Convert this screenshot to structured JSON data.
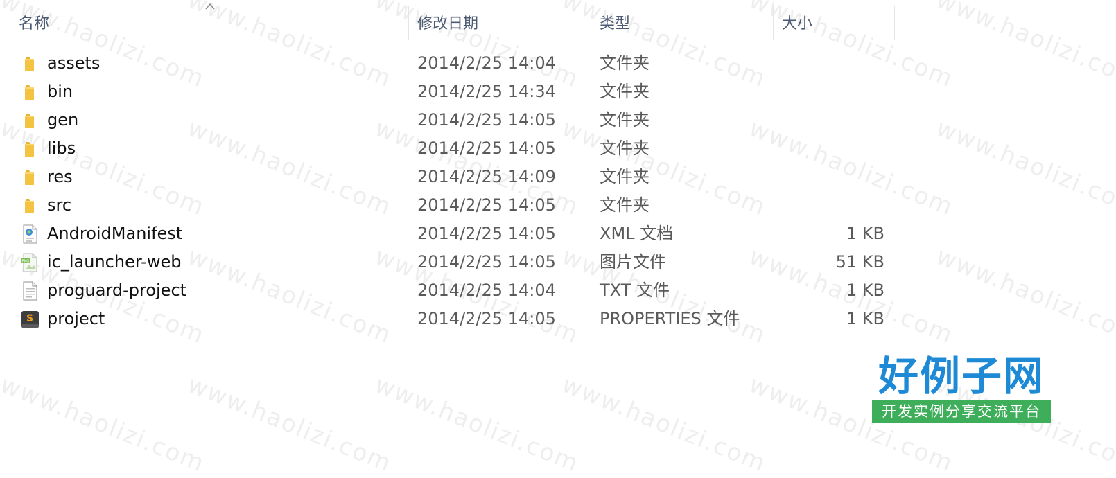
{
  "columns": {
    "name": "名称",
    "date": "修改日期",
    "type": "类型",
    "size": "大小"
  },
  "files": [
    {
      "icon": "folder-icon",
      "name": "assets",
      "date": "2014/2/25 14:04",
      "type": "文件夹",
      "size": ""
    },
    {
      "icon": "folder-icon",
      "name": "bin",
      "date": "2014/2/25 14:34",
      "type": "文件夹",
      "size": ""
    },
    {
      "icon": "folder-icon",
      "name": "gen",
      "date": "2014/2/25 14:05",
      "type": "文件夹",
      "size": ""
    },
    {
      "icon": "folder-icon",
      "name": "libs",
      "date": "2014/2/25 14:05",
      "type": "文件夹",
      "size": ""
    },
    {
      "icon": "folder-icon",
      "name": "res",
      "date": "2014/2/25 14:09",
      "type": "文件夹",
      "size": ""
    },
    {
      "icon": "folder-icon",
      "name": "src",
      "date": "2014/2/25 14:05",
      "type": "文件夹",
      "size": ""
    },
    {
      "icon": "xml-file-icon",
      "name": "AndroidManifest",
      "date": "2014/2/25 14:05",
      "type": "XML 文档",
      "size": "1 KB"
    },
    {
      "icon": "png-image-icon",
      "name": "ic_launcher-web",
      "date": "2014/2/25 14:05",
      "type": "图片文件",
      "size": "51 KB"
    },
    {
      "icon": "text-file-icon",
      "name": "proguard-project",
      "date": "2014/2/25 14:04",
      "type": "TXT 文件",
      "size": "1 KB"
    },
    {
      "icon": "sublime-file-icon",
      "name": "project",
      "date": "2014/2/25 14:05",
      "type": "PROPERTIES 文件",
      "size": "1 KB"
    }
  ],
  "watermark": "www.haolizi.com",
  "logo": {
    "title": "好例子网",
    "subtitle": "开发实例分享交流平台"
  },
  "colors": {
    "header_text": "#4c5a73",
    "folder": "#f5c342",
    "logo_blue": "#1e8ad6",
    "logo_green": "#3fae5a"
  }
}
